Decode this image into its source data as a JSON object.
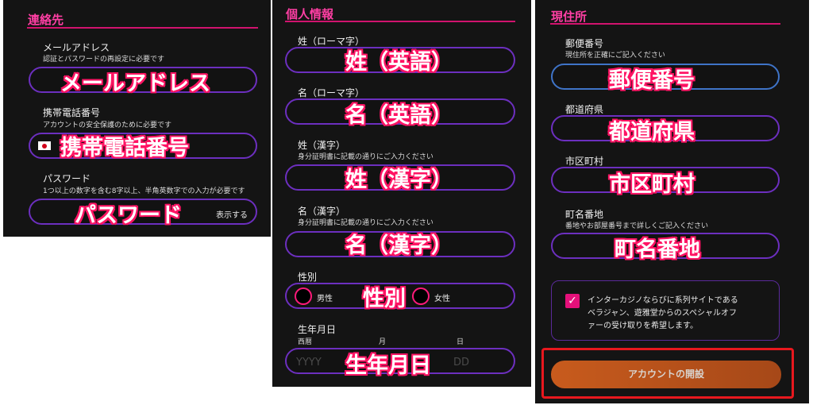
{
  "contact": {
    "title": "連絡先",
    "email": {
      "label": "メールアドレス",
      "hint": "認証とパスワードの再設定に必要です",
      "overlay": "メールアドレス"
    },
    "phone": {
      "label": "携帯電話番号",
      "hint": "アカウントの安全保護のために必要です",
      "overlay": "携帯電話番号"
    },
    "password": {
      "label": "パスワード",
      "hint": "1つ以上の数字を含む8字以上、半角英数字での入力が必要です",
      "overlay": "パスワード",
      "toggle": "表示する"
    }
  },
  "personal": {
    "title": "個人情報",
    "last_name_en": {
      "label": "姓（ローマ字）",
      "overlay": "姓（英語）"
    },
    "first_name_en": {
      "label": "名（ローマ字）",
      "overlay": "名（英語）"
    },
    "last_name_kanji": {
      "label": "姓（漢字）",
      "hint": "身分証明書に記載の通りにご入力ください",
      "overlay": "姓（漢字）"
    },
    "first_name_kanji": {
      "label": "名（漢字）",
      "hint": "身分証明書に記載の通りにご入力ください",
      "overlay": "名（漢字）"
    },
    "gender": {
      "label": "性別",
      "male": "男性",
      "female": "女性",
      "overlay": "性別"
    },
    "birthdate": {
      "label": "生年月日",
      "year_label": "西暦",
      "month_label": "月",
      "day_label": "日",
      "year_placeholder": "YYYY",
      "day_placeholder": "DD",
      "overlay": "生年月日"
    }
  },
  "address": {
    "title": "現住所",
    "postal": {
      "label": "郵便番号",
      "hint": "現住所を正確にご記入ください",
      "overlay": "郵便番号"
    },
    "prefecture": {
      "label": "都道府県",
      "overlay": "都道府県"
    },
    "city": {
      "label": "市区町村",
      "overlay": "市区町村"
    },
    "street": {
      "label": "町名番地",
      "hint": "番地やお部屋番号まで詳しくご記入ください",
      "overlay": "町名番地"
    },
    "consent_lines": [
      "インターカジノならびに系列サイトである",
      "ベラジャン、遊雅堂からのスペシャルオフ",
      "ァーの受け取りを希望します。"
    ],
    "submit_label": "アカウントの開設"
  },
  "colors": {
    "accent": "#ff3fa4",
    "field_border": "#6c2fbf",
    "annotation": "#ff1464",
    "highlight": "#e8181e"
  }
}
